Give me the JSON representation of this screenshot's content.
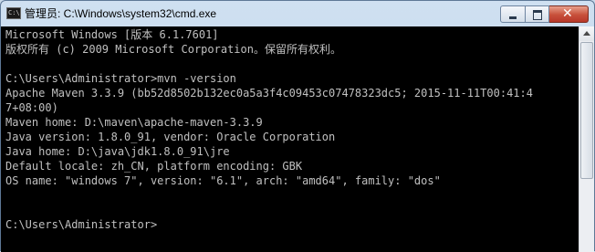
{
  "window": {
    "title": "管理员: C:\\Windows\\system32\\cmd.exe",
    "icon": "cmd-icon"
  },
  "caption_buttons": {
    "minimize_icon": "minimize-icon",
    "maximize_icon": "maximize-icon",
    "close_glyph": "✕"
  },
  "console": {
    "lines": [
      "Microsoft Windows [版本 6.1.7601]",
      "版权所有 (c) 2009 Microsoft Corporation。保留所有权利。",
      "",
      "C:\\Users\\Administrator>mvn -version",
      "Apache Maven 3.3.9 (bb52d8502b132ec0a5a3f4c09453c07478323dc5; 2015-11-11T00:41:4",
      "7+08:00)",
      "Maven home: D:\\maven\\apache-maven-3.3.9",
      "Java version: 1.8.0_91, vendor: Oracle Corporation",
      "Java home: D:\\java\\jdk1.8.0_91\\jre",
      "Default locale: zh_CN, platform encoding: GBK",
      "OS name: \"windows 7\", version: \"6.1\", arch: \"amd64\", family: \"dos\"",
      "",
      "",
      "C:\\Users\\Administrator>"
    ]
  }
}
